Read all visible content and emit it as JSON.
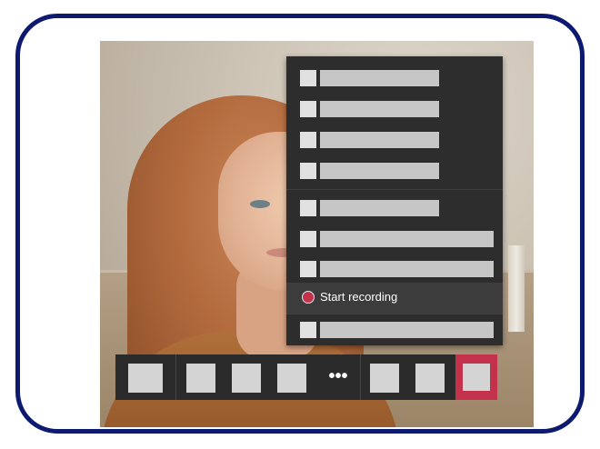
{
  "menu": {
    "items": [
      {
        "kind": "placeholder",
        "width": "short"
      },
      {
        "kind": "placeholder",
        "width": "short"
      },
      {
        "kind": "placeholder",
        "width": "short"
      },
      {
        "kind": "placeholder",
        "width": "short"
      },
      {
        "kind": "placeholder",
        "width": "short"
      },
      {
        "kind": "placeholder",
        "width": "long"
      },
      {
        "kind": "placeholder",
        "width": "long"
      },
      {
        "kind": "record",
        "label": "Start recording",
        "icon": "record-icon",
        "color": "#c4314b"
      },
      {
        "kind": "placeholder",
        "width": "long"
      }
    ]
  },
  "toolbar": {
    "more_label": "•••",
    "leave_color": "#c4314b",
    "icons": [
      "camera-icon",
      "microphone-icon",
      "share-icon",
      "chat-icon",
      "participants-icon",
      "more-options-icon",
      "reaction-icon",
      "raise-hand-icon",
      "leave-call-icon"
    ]
  },
  "frame": {
    "border_color": "#0d1a70"
  }
}
